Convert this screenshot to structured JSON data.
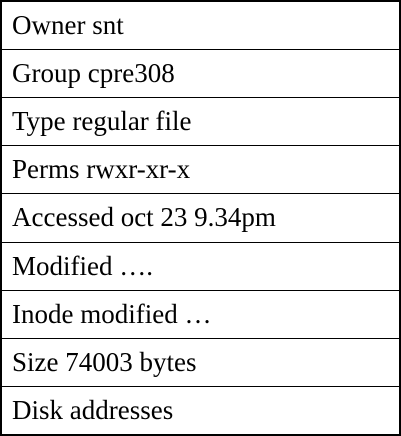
{
  "inode": {
    "rows": [
      "Owner snt",
      "Group cpre308",
      "Type regular file",
      "Perms rwxr-xr-x",
      "Accessed oct 23 9.34pm",
      "Modified ….",
      "Inode modified …",
      "Size 74003 bytes",
      "Disk addresses"
    ]
  }
}
